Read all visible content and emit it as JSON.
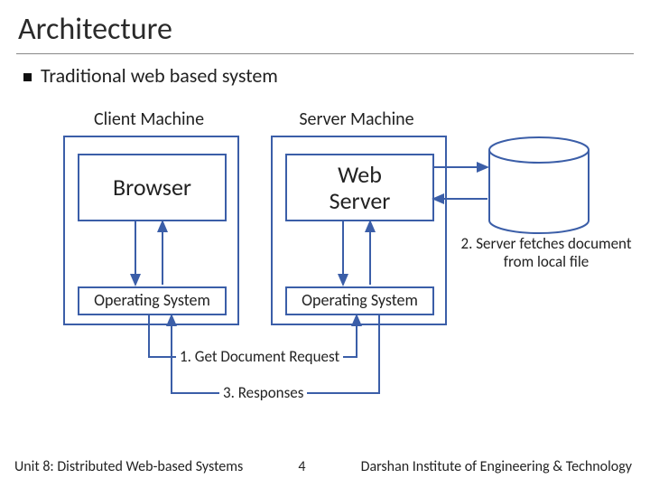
{
  "title": "Architecture",
  "bullet": "Traditional web based system",
  "labels": {
    "client": "Client Machine",
    "server": "Server Machine"
  },
  "boxes": {
    "browser": "Browser",
    "webserver": "Web\nServer",
    "os_client": "Operating System",
    "os_server": "Operating System"
  },
  "flows": {
    "step1": "1. Get Document Request",
    "step2": "2. Server fetches document\nfrom local file",
    "step3": "3. Responses"
  },
  "footer": {
    "unit": "Unit 8: Distributed Web-based Systems",
    "page": "4",
    "org": "Darshan Institute of Engineering & Technology"
  },
  "colors": {
    "box": "#3b5ea8",
    "line": "#3b5ea8"
  }
}
